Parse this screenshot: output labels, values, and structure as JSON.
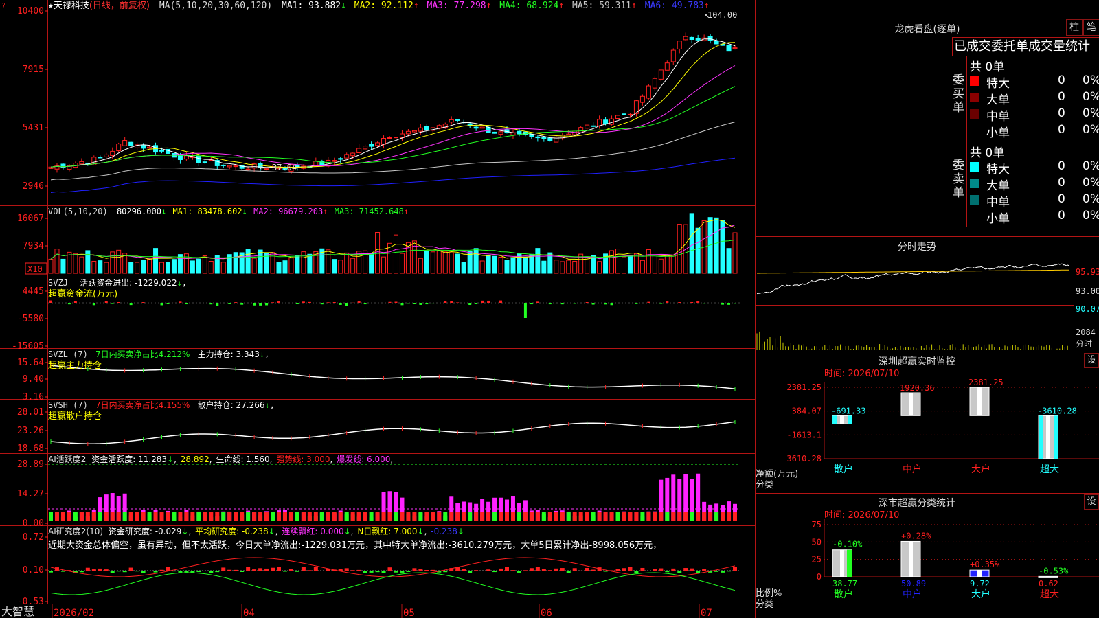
{
  "colors": {
    "up": "#ff2020",
    "down": "#22ffff",
    "ma1": "#ffffff",
    "ma2": "#ffff00",
    "ma3": "#ff33ff",
    "ma4": "#22ff22",
    "ma5": "#c8c8c8",
    "ma6": "#2020ff",
    "frame": "#b41414"
  },
  "main": {
    "star": "★",
    "name": "天禄科技",
    "period": "(日线，前复权)",
    "ma_spec": "MA(5,10,20,30,60,120)",
    "ma1": "MA1: 93.882",
    "ma2": "MA2: 92.112",
    "ma3": "MA3: 77.298",
    "ma4": "MA4: 68.924",
    "ma5": "MA5: 59.311",
    "ma6": "MA6: 49.783",
    "arrows": {
      "ma1": "↓",
      "ma2": "↑",
      "ma3": "↑",
      "ma4": "↑",
      "ma5": "↑",
      "ma6": "↑"
    },
    "y_ticks": [
      "10400",
      "7915",
      "5431",
      "2946"
    ],
    "high_label": "104.00",
    "low_label": "37.04"
  },
  "vol": {
    "title": "VOL(5,10,20)",
    "value": "80296.000",
    "arrow": "↓",
    "ma1": "MA1: 83478.602",
    "ma1_arrow": "↓",
    "ma2": "MA2: 96679.203",
    "ma2_arrow": "↑",
    "ma3": "MA3: 71452.648",
    "ma3_arrow": "↑",
    "y_ticks": [
      "16067",
      "7934"
    ],
    "unit": "X10"
  },
  "svzj": {
    "title": "SVZJ",
    "label": "活跃资金进出: -1229.022",
    "arrow": "↓",
    "sub": "超赢资金流(万元)",
    "y_ticks": [
      "4445",
      "-5580",
      "-15605"
    ]
  },
  "svzl": {
    "title": "SVZL (7)",
    "label": "7日内买卖净占比4.212%",
    "hold": "主力持仓: 3.343",
    "arrow": "↓",
    "sub": "超赢主力持仓",
    "y_ticks": [
      "15.64",
      "9.40",
      "3.16"
    ]
  },
  "svsh": {
    "title": "SVSH (7)",
    "label": "7日内买卖净占比4.155%",
    "hold": "散户持仓: 27.266",
    "arrow": "↓",
    "sub": "超赢散户持仓",
    "y_ticks": [
      "28.01",
      "23.26",
      "18.68"
    ]
  },
  "ai_active": {
    "title": "AI活跃度2",
    "label": "资金活跃度: 11.283",
    "arrow": "↓",
    "val2": "28.892",
    "life": "生命线: 1.560",
    "strong": "强势线: 3.000",
    "burst": "爆发线: 6.000",
    "y_ticks": [
      "28.89",
      "14.27",
      "0.00"
    ]
  },
  "ai_research": {
    "title": "AI研究度2(10)",
    "label": "资金研究度: -0.029",
    "arrow": "↓",
    "avg": "平均研究度: -0.238",
    "avg_arrow": "↓",
    "red": "连续飘红: 0.000",
    "red_arrow": "↓",
    "nred": "N日飘红: 7.000",
    "nred_arrow": "↓",
    "last": "-0.238",
    "last_arrow": "↓",
    "comment": "近期大资金总体偏空，虽有异动，但不太活跃，今日大单净流出:-1229.031万元，其中特大单净流出:-3610.279万元，大单5日累计净出-8998.056万元，",
    "y_ticks": [
      "0.72",
      "0.10",
      "-0.53"
    ]
  },
  "xaxis": {
    "brand": "大智慧",
    "months": [
      "2026/02",
      "04",
      "05",
      "06",
      "07"
    ]
  },
  "right": {
    "dragon_title": "龙虎看盘(逐单)",
    "btn_bar": "柱",
    "btn_pen": "笔",
    "stats_header": "已成交委托单成交量统计",
    "buy_label": "委买单",
    "sell_label": "委卖单",
    "buy_total": "共 0单",
    "sell_total": "共 0单",
    "buy_rows": [
      {
        "name": "特大",
        "count": "0",
        "pct": "0%",
        "color": "#ff0000"
      },
      {
        "name": "大单",
        "count": "0",
        "pct": "0%",
        "color": "#8b0000"
      },
      {
        "name": "中单",
        "count": "0",
        "pct": "0%",
        "color": "#6a0000"
      },
      {
        "name": "小单",
        "count": "0",
        "pct": "0%",
        "color": ""
      }
    ],
    "sell_rows": [
      {
        "name": "特大",
        "count": "0",
        "pct": "0%",
        "color": "#00ffff"
      },
      {
        "name": "大单",
        "count": "0",
        "pct": "0%",
        "color": "#008b8b"
      },
      {
        "name": "中单",
        "count": "0",
        "pct": "0%",
        "color": "#007070"
      },
      {
        "name": "小单",
        "count": "0",
        "pct": "0%",
        "color": ""
      }
    ],
    "intraday": {
      "title": "分时走势",
      "y_ticks": [
        "95.93",
        "93.00",
        "90.07"
      ],
      "vol_tick": "2084",
      "vol_unit": "分时"
    },
    "monitor": {
      "title": "深圳超赢实时监控",
      "btn": "设",
      "time": "时间: 2026/07/10",
      "y_ticks": [
        "2381.25",
        "384.07",
        "-1613.1",
        "-3610.28"
      ],
      "y_label": "净额(万元)",
      "x_label": "分类",
      "categories": [
        "散户",
        "中户",
        "大户",
        "超大"
      ],
      "values": [
        -691.33,
        1920.36,
        2381.25,
        -3610.28
      ],
      "value_labels": [
        "-691.33",
        "1920.36",
        "2381.25",
        "-3610.28"
      ],
      "ylim": [
        -3610.28,
        2381.25
      ]
    },
    "classify": {
      "title": "深市超赢分类统计",
      "btn": "设",
      "time": "时间: 2026/07/10",
      "y_ticks": [
        "75",
        "50",
        "25",
        "0"
      ],
      "y_label": "比例%",
      "x_label": "分类",
      "categories": [
        "散户",
        "中户",
        "大户",
        "超大"
      ],
      "values": [
        38.77,
        50.89,
        9.72,
        0.62
      ],
      "value_labels": [
        "38.77",
        "50.89",
        "9.72",
        "0.62"
      ],
      "changes": [
        "-0.10%",
        "+0.28%",
        "+0.35%",
        "-0.53%"
      ],
      "ylim": [
        0,
        75
      ]
    }
  }
}
